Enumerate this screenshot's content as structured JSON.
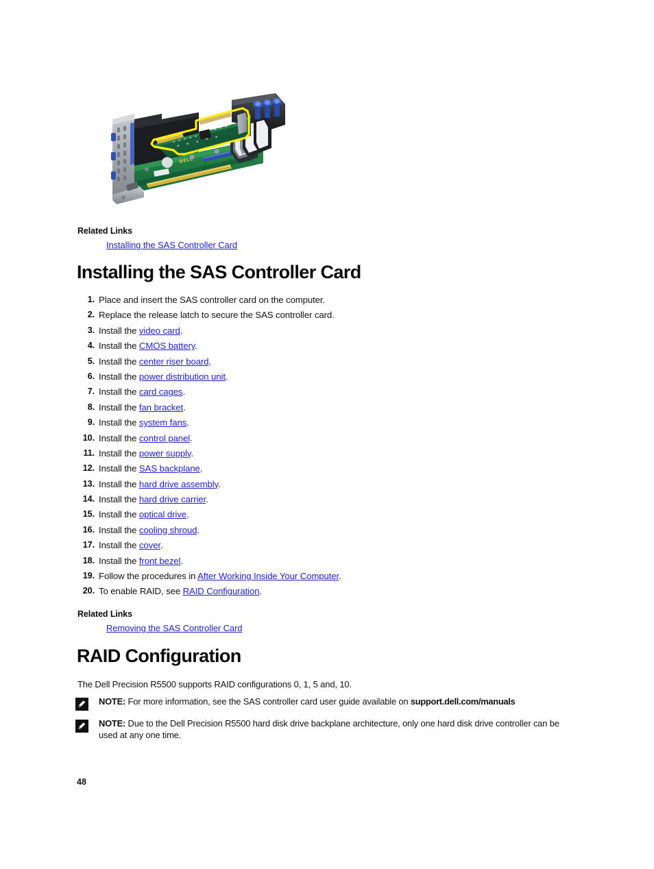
{
  "document": {
    "page_number": "48",
    "link_color": "#2222cc",
    "text_color": "#111111"
  },
  "figure": {
    "caption": "",
    "alt_name": "sas-controller-card-riser-assembly",
    "highlight_color": "#ffee00",
    "pcb_color": "#1f7a3d",
    "bracket_color": "#9aa0a6",
    "connector_color": "#2b57c4"
  },
  "related_links_top": {
    "heading": "Related Links",
    "links": [
      {
        "label": "Installing the SAS Controller Card"
      }
    ]
  },
  "section_install": {
    "title": "Installing the SAS Controller Card",
    "steps": [
      {
        "num": "1.",
        "pre": "Place and insert the SAS controller card on the computer.",
        "link": "",
        "post": ""
      },
      {
        "num": "2.",
        "pre": "Replace the release latch to secure the SAS controller card.",
        "link": "",
        "post": ""
      },
      {
        "num": "3.",
        "pre": "Install the ",
        "link": "video card",
        "post": "."
      },
      {
        "num": "4.",
        "pre": "Install the ",
        "link": "CMOS battery",
        "post": "."
      },
      {
        "num": "5.",
        "pre": "Install the ",
        "link": "center riser board",
        "post": "."
      },
      {
        "num": "6.",
        "pre": "Install the ",
        "link": "power distribution unit",
        "post": "."
      },
      {
        "num": "7.",
        "pre": "Install the ",
        "link": "card cages",
        "post": "."
      },
      {
        "num": "8.",
        "pre": "Install the ",
        "link": "fan bracket",
        "post": "."
      },
      {
        "num": "9.",
        "pre": "Install the ",
        "link": "system fans",
        "post": "."
      },
      {
        "num": "10.",
        "pre": "Install the ",
        "link": "control panel",
        "post": "."
      },
      {
        "num": "11.",
        "pre": "Install the ",
        "link": "power supply",
        "post": "."
      },
      {
        "num": "12.",
        "pre": "Install the ",
        "link": "SAS backplane",
        "post": "."
      },
      {
        "num": "13.",
        "pre": "Install the ",
        "link": "hard drive assembly",
        "post": "."
      },
      {
        "num": "14.",
        "pre": "Install the ",
        "link": "hard drive carrier",
        "post": "."
      },
      {
        "num": "15.",
        "pre": "Install the ",
        "link": "optical drive",
        "post": "."
      },
      {
        "num": "16.",
        "pre": "Install the ",
        "link": "cooling shroud",
        "post": "."
      },
      {
        "num": "17.",
        "pre": "Install the ",
        "link": "cover",
        "post": "."
      },
      {
        "num": "18.",
        "pre": "Install the ",
        "link": "front bezel",
        "post": "."
      },
      {
        "num": "19.",
        "pre": "Follow the procedures in ",
        "link": "After Working Inside Your Computer",
        "post": "."
      },
      {
        "num": "20.",
        "pre": "To enable RAID, see ",
        "link": "RAID Configuration",
        "post": "."
      }
    ]
  },
  "related_links_bottom": {
    "heading": "Related Links",
    "links": [
      {
        "label": "Removing the SAS Controller Card"
      }
    ]
  },
  "section_raid": {
    "title": "RAID Configuration",
    "paragraph": "The Dell Precision R5500 supports RAID configurations 0, 1, 5 and, 10.",
    "notes": [
      {
        "icon": "note-pencil-icon",
        "label": "NOTE:",
        "text": " For more information, see the SAS controller card user guide available on ",
        "bold_tail": "support.dell.com/manuals",
        "tail": ""
      },
      {
        "icon": "note-pencil-icon",
        "label": "NOTE:",
        "text": " Due to the Dell Precision R5500 hard disk drive backplane architecture, only one hard disk drive controller can be used at any one time.",
        "bold_tail": "",
        "tail": ""
      }
    ]
  }
}
